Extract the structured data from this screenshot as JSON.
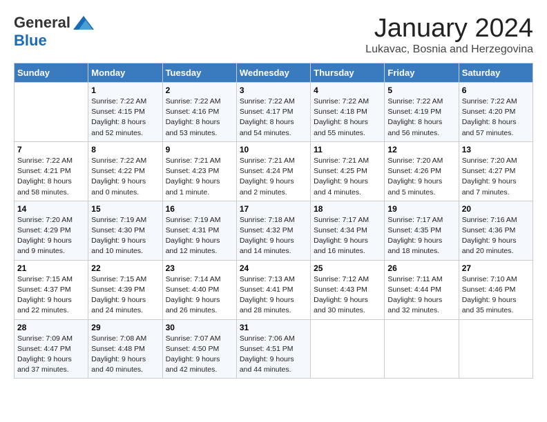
{
  "header": {
    "logo_general": "General",
    "logo_blue": "Blue",
    "title": "January 2024",
    "subtitle": "Lukavac, Bosnia and Herzegovina"
  },
  "weekdays": [
    "Sunday",
    "Monday",
    "Tuesday",
    "Wednesday",
    "Thursday",
    "Friday",
    "Saturday"
  ],
  "weeks": [
    [
      {
        "day": "",
        "info": ""
      },
      {
        "day": "1",
        "info": "Sunrise: 7:22 AM\nSunset: 4:15 PM\nDaylight: 8 hours\nand 52 minutes."
      },
      {
        "day": "2",
        "info": "Sunrise: 7:22 AM\nSunset: 4:16 PM\nDaylight: 8 hours\nand 53 minutes."
      },
      {
        "day": "3",
        "info": "Sunrise: 7:22 AM\nSunset: 4:17 PM\nDaylight: 8 hours\nand 54 minutes."
      },
      {
        "day": "4",
        "info": "Sunrise: 7:22 AM\nSunset: 4:18 PM\nDaylight: 8 hours\nand 55 minutes."
      },
      {
        "day": "5",
        "info": "Sunrise: 7:22 AM\nSunset: 4:19 PM\nDaylight: 8 hours\nand 56 minutes."
      },
      {
        "day": "6",
        "info": "Sunrise: 7:22 AM\nSunset: 4:20 PM\nDaylight: 8 hours\nand 57 minutes."
      }
    ],
    [
      {
        "day": "7",
        "info": "Sunrise: 7:22 AM\nSunset: 4:21 PM\nDaylight: 8 hours\nand 58 minutes."
      },
      {
        "day": "8",
        "info": "Sunrise: 7:22 AM\nSunset: 4:22 PM\nDaylight: 9 hours\nand 0 minutes."
      },
      {
        "day": "9",
        "info": "Sunrise: 7:21 AM\nSunset: 4:23 PM\nDaylight: 9 hours\nand 1 minute."
      },
      {
        "day": "10",
        "info": "Sunrise: 7:21 AM\nSunset: 4:24 PM\nDaylight: 9 hours\nand 2 minutes."
      },
      {
        "day": "11",
        "info": "Sunrise: 7:21 AM\nSunset: 4:25 PM\nDaylight: 9 hours\nand 4 minutes."
      },
      {
        "day": "12",
        "info": "Sunrise: 7:20 AM\nSunset: 4:26 PM\nDaylight: 9 hours\nand 5 minutes."
      },
      {
        "day": "13",
        "info": "Sunrise: 7:20 AM\nSunset: 4:27 PM\nDaylight: 9 hours\nand 7 minutes."
      }
    ],
    [
      {
        "day": "14",
        "info": "Sunrise: 7:20 AM\nSunset: 4:29 PM\nDaylight: 9 hours\nand 9 minutes."
      },
      {
        "day": "15",
        "info": "Sunrise: 7:19 AM\nSunset: 4:30 PM\nDaylight: 9 hours\nand 10 minutes."
      },
      {
        "day": "16",
        "info": "Sunrise: 7:19 AM\nSunset: 4:31 PM\nDaylight: 9 hours\nand 12 minutes."
      },
      {
        "day": "17",
        "info": "Sunrise: 7:18 AM\nSunset: 4:32 PM\nDaylight: 9 hours\nand 14 minutes."
      },
      {
        "day": "18",
        "info": "Sunrise: 7:17 AM\nSunset: 4:34 PM\nDaylight: 9 hours\nand 16 minutes."
      },
      {
        "day": "19",
        "info": "Sunrise: 7:17 AM\nSunset: 4:35 PM\nDaylight: 9 hours\nand 18 minutes."
      },
      {
        "day": "20",
        "info": "Sunrise: 7:16 AM\nSunset: 4:36 PM\nDaylight: 9 hours\nand 20 minutes."
      }
    ],
    [
      {
        "day": "21",
        "info": "Sunrise: 7:15 AM\nSunset: 4:37 PM\nDaylight: 9 hours\nand 22 minutes."
      },
      {
        "day": "22",
        "info": "Sunrise: 7:15 AM\nSunset: 4:39 PM\nDaylight: 9 hours\nand 24 minutes."
      },
      {
        "day": "23",
        "info": "Sunrise: 7:14 AM\nSunset: 4:40 PM\nDaylight: 9 hours\nand 26 minutes."
      },
      {
        "day": "24",
        "info": "Sunrise: 7:13 AM\nSunset: 4:41 PM\nDaylight: 9 hours\nand 28 minutes."
      },
      {
        "day": "25",
        "info": "Sunrise: 7:12 AM\nSunset: 4:43 PM\nDaylight: 9 hours\nand 30 minutes."
      },
      {
        "day": "26",
        "info": "Sunrise: 7:11 AM\nSunset: 4:44 PM\nDaylight: 9 hours\nand 32 minutes."
      },
      {
        "day": "27",
        "info": "Sunrise: 7:10 AM\nSunset: 4:46 PM\nDaylight: 9 hours\nand 35 minutes."
      }
    ],
    [
      {
        "day": "28",
        "info": "Sunrise: 7:09 AM\nSunset: 4:47 PM\nDaylight: 9 hours\nand 37 minutes."
      },
      {
        "day": "29",
        "info": "Sunrise: 7:08 AM\nSunset: 4:48 PM\nDaylight: 9 hours\nand 40 minutes."
      },
      {
        "day": "30",
        "info": "Sunrise: 7:07 AM\nSunset: 4:50 PM\nDaylight: 9 hours\nand 42 minutes."
      },
      {
        "day": "31",
        "info": "Sunrise: 7:06 AM\nSunset: 4:51 PM\nDaylight: 9 hours\nand 44 minutes."
      },
      {
        "day": "",
        "info": ""
      },
      {
        "day": "",
        "info": ""
      },
      {
        "day": "",
        "info": ""
      }
    ]
  ]
}
